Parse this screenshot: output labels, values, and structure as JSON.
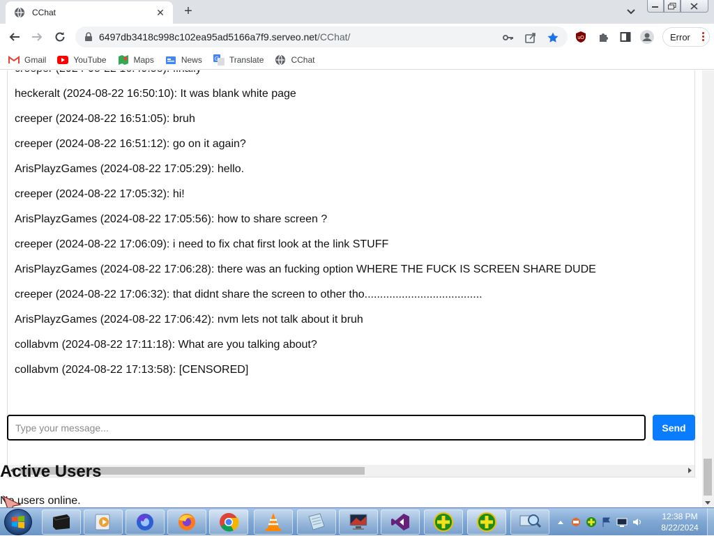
{
  "browser": {
    "tab_title": "CChat",
    "url_host": "6497db3418c998c102ea95ad5166a7f9.serveo.net",
    "url_path": "/CChat/",
    "profile_status": "Error"
  },
  "bookmarks": [
    {
      "label": "Gmail",
      "icon": "gmail-icon"
    },
    {
      "label": "YouTube",
      "icon": "youtube-icon"
    },
    {
      "label": "Maps",
      "icon": "maps-icon"
    },
    {
      "label": "News",
      "icon": "news-icon"
    },
    {
      "label": "Translate",
      "icon": "translate-icon"
    },
    {
      "label": "CChat",
      "icon": "globe-icon"
    }
  ],
  "chat": {
    "messages": [
      {
        "text": "heckeralt (2024-08-22 16:50:10): It was blank white page"
      },
      {
        "text": "creeper (2024-08-22 16:51:05): bruh"
      },
      {
        "text": "creeper (2024-08-22 16:51:12): go on it again?"
      },
      {
        "text": "ArisPlayzGames (2024-08-22 17:05:29): hello."
      },
      {
        "text": "creeper (2024-08-22 17:05:32): hi!"
      },
      {
        "text": "ArisPlayzGames (2024-08-22 17:05:56): how to share screen ?"
      },
      {
        "text": "creeper (2024-08-22 17:06:09): i need to fix chat first look at the link STUFF"
      },
      {
        "text": "ArisPlayzGames (2024-08-22 17:06:28): there was an fucking option WHERE THE FUCK IS SCREEN SHARE DUDE"
      },
      {
        "text": "creeper (2024-08-22 17:06:32): that didnt share the screen to other tho......................................"
      },
      {
        "text": "ArisPlayzGames (2024-08-22 17:06:42): nvm lets not talk about it bruh"
      },
      {
        "text": "collabvm (2024-08-22 17:11:18): What are you talking about?"
      },
      {
        "text": "collabvm (2024-08-22 17:13:58): [CENSORED]"
      }
    ],
    "input_placeholder": "Type your message...",
    "send_label": "Send"
  },
  "active_users": {
    "title": "Active Users",
    "status": "No users online."
  },
  "taskbar": {
    "time": "12:38 PM",
    "date": "8/22/2024",
    "apps": [
      "terminal-icon",
      "media-player-icon",
      "firefox-dev-icon",
      "firefox-icon",
      "chrome-icon",
      "vlc-icon",
      "notepad-icon",
      "remote-desktop-icon",
      "visual-studio-icon",
      "green-plus-icon",
      "green-plus-icon",
      "network-magnifier-icon"
    ]
  },
  "colors": {
    "send_button": "#0a7cff",
    "bookmark_star": "#1a73e8"
  }
}
